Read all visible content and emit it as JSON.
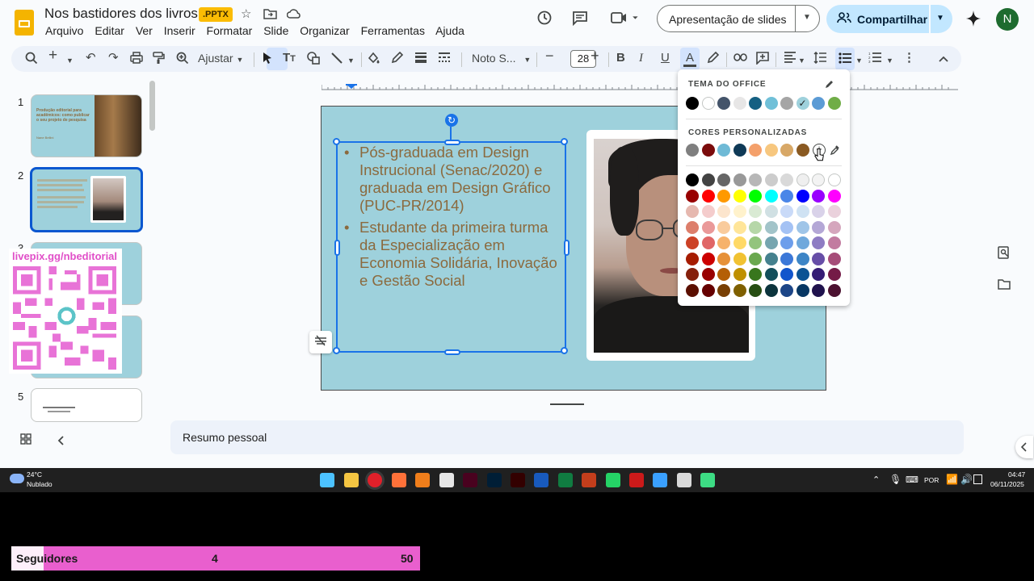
{
  "header": {
    "doc_title": "Nos bastidores dos livros",
    "badge": ".PPTX",
    "menu": [
      "Arquivo",
      "Editar",
      "Ver",
      "Inserir",
      "Formatar",
      "Slide",
      "Organizar",
      "Ferramentas",
      "Ajuda"
    ],
    "slideshow_label": "Apresentação de slides",
    "share_label": "Compartilhar",
    "avatar_initial": "N"
  },
  "toolbar": {
    "zoom_label": "Ajustar",
    "font_name": "Noto S...",
    "font_size": "28"
  },
  "filmstrip": {
    "numbers": [
      "1",
      "2",
      "3",
      "4",
      "5"
    ],
    "slide1_text": "Produção editorial para acadêmicos: como publicar o seu projeto de pesquisa",
    "slide1_author": "Nane Bellini"
  },
  "overlay": {
    "qr_url": "livepix.gg/nbeditorial"
  },
  "slide": {
    "bullets": [
      "Pós-graduada em Design Instrucional (Senac/2020) e graduada em Design Gráfico (PUC-PR/2014)",
      "Estudante da primeira turma da Especialização em Economia Solidária, Inovação e Gestão Social"
    ]
  },
  "notes": {
    "text": "Resumo pessoal"
  },
  "color_picker": {
    "theme_title": "TEMA DO OFFICE",
    "custom_title": "CORES PERSONALIZADAS",
    "theme_colors": [
      "#000000",
      "#ffffff",
      "#44546a",
      "#e7e6e6",
      "#156082",
      "#70c0d8",
      "#a5a5a5",
      "#9ed1dc",
      "#5b9bd5",
      "#70ad47"
    ],
    "custom_colors": [
      "#7f7f7f",
      "#7b0c0c",
      "#6fbad6",
      "#0f3a57",
      "#f4a06b",
      "#f7c77f",
      "#d8a867",
      "#8a5a22"
    ],
    "palette_rows": [
      [
        "#000000",
        "#434343",
        "#666666",
        "#999999",
        "#b7b7b7",
        "#cccccc",
        "#d9d9d9",
        "#efefef",
        "#f3f3f3",
        "#ffffff"
      ],
      [
        "#980000",
        "#ff0000",
        "#ff9900",
        "#ffff00",
        "#00ff00",
        "#00ffff",
        "#4a86e8",
        "#0000ff",
        "#9900ff",
        "#ff00ff"
      ],
      [
        "#e6b8af",
        "#f4cccc",
        "#fce5cd",
        "#fff2cc",
        "#d9ead3",
        "#d0e0e3",
        "#c9daf8",
        "#cfe2f3",
        "#d9d2e9",
        "#ead1dc"
      ],
      [
        "#dd7e6b",
        "#ea9999",
        "#f9cb9c",
        "#ffe599",
        "#b6d7a8",
        "#a2c4c9",
        "#a4c2f4",
        "#9fc5e8",
        "#b4a7d6",
        "#d5a6bd"
      ],
      [
        "#cc4125",
        "#e06666",
        "#f6b26b",
        "#ffd966",
        "#93c47d",
        "#76a5af",
        "#6d9eeb",
        "#6fa8dc",
        "#8e7cc3",
        "#c27ba0"
      ],
      [
        "#a61c00",
        "#cc0000",
        "#e69138",
        "#f1c232",
        "#6aa84f",
        "#45818e",
        "#3c78d8",
        "#3d85c6",
        "#674ea7",
        "#a64d79"
      ],
      [
        "#85200c",
        "#990000",
        "#b45f06",
        "#bf9000",
        "#38761d",
        "#134f5c",
        "#1155cc",
        "#0b5394",
        "#351c75",
        "#741b47"
      ],
      [
        "#5b0f00",
        "#660000",
        "#783f04",
        "#7f6000",
        "#274e13",
        "#0c343d",
        "#1c4587",
        "#073763",
        "#20124d",
        "#4c1130"
      ]
    ]
  },
  "taskbar": {
    "weather_temp": "24°C",
    "weather_desc": "Nublado",
    "lang": "POR",
    "time": "04:47",
    "date": "06/11/2025"
  },
  "followers": {
    "label": "Seguidores",
    "current": "4",
    "goal": "50",
    "progress": 0.08
  }
}
